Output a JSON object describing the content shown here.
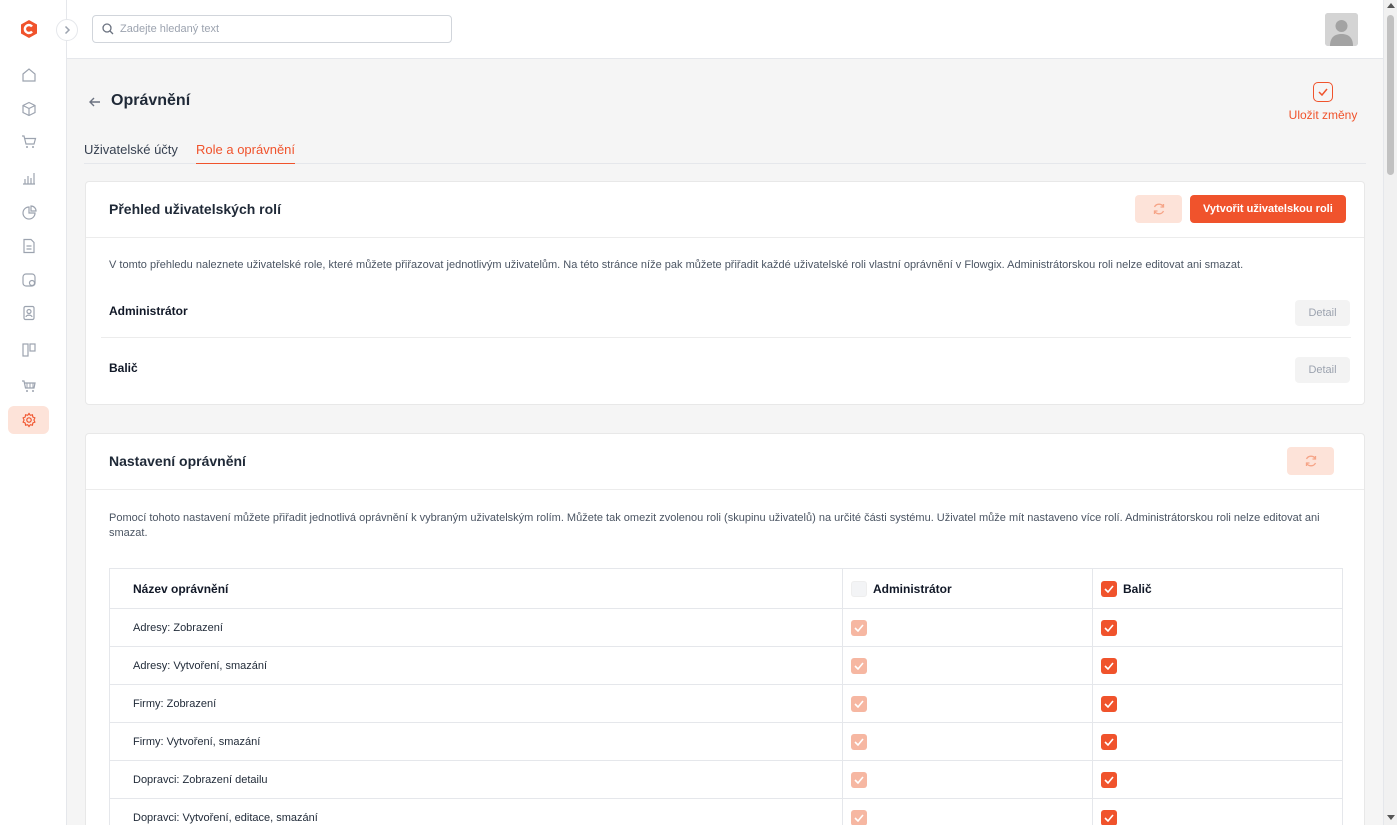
{
  "colors": {
    "accent": "#f0532c",
    "accent_soft": "#fde3d9"
  },
  "sidebar": {
    "items": [
      {
        "icon": "home-icon"
      },
      {
        "icon": "box-icon"
      },
      {
        "icon": "cart-icon"
      },
      {
        "icon": "chart-icon"
      },
      {
        "icon": "pie-chart-icon"
      },
      {
        "icon": "document-icon"
      },
      {
        "icon": "user-settings-icon"
      },
      {
        "icon": "contacts-icon"
      },
      {
        "icon": "kanban-icon"
      },
      {
        "icon": "shop-cart-icon"
      },
      {
        "icon": "gear-icon",
        "active": true
      }
    ]
  },
  "search": {
    "placeholder": "Zadejte hledaný text"
  },
  "page": {
    "title": "Oprávnění",
    "save_label": "Uložit změny",
    "tabs": [
      {
        "label": "Uživatelské účty"
      },
      {
        "label": "Role a oprávnění",
        "active": true
      }
    ]
  },
  "roles_card": {
    "title": "Přehled uživatelských rolí",
    "create_label": "Vytvořit uživatelskou roli",
    "description": "V tomto přehledu naleznete uživatelské role, které můžete přiřazovat jednotlivým uživatelům. Na této stránce níže pak můžete přiřadit každé uživatelské roli vlastní oprávnění v Flowgix. Administrátorskou roli nelze editovat ani smazat.",
    "roles": [
      {
        "name": "Administrátor",
        "detail_label": "Detail"
      },
      {
        "name": "Balič",
        "detail_label": "Detail"
      }
    ]
  },
  "permissions_card": {
    "title": "Nastavení oprávnění",
    "description": "Pomocí tohoto nastavení můžete přiřadit jednotlivá oprávnění k vybraným uživatelským rolím. Můžete tak omezit zvolenou roli (skupinu uživatelů) na určité části systému. Uživatel může mít nastaveno více rolí. Administrátorskou roli nelze editovat ani smazat.",
    "table": {
      "col_name": "Název oprávnění",
      "col_admin": "Administrátor",
      "col_balic": "Balič",
      "rows": [
        {
          "name": "Adresy: Zobrazení",
          "admin": true,
          "balic": true
        },
        {
          "name": "Adresy: Vytvoření, smazání",
          "admin": true,
          "balic": true
        },
        {
          "name": "Firmy: Zobrazení",
          "admin": true,
          "balic": true
        },
        {
          "name": "Firmy: Vytvoření, smazání",
          "admin": true,
          "balic": true
        },
        {
          "name": "Dopravci: Zobrazení detailu",
          "admin": true,
          "balic": true
        },
        {
          "name": "Dopravci: Vytvoření, editace, smazání",
          "admin": true,
          "balic": true
        }
      ]
    }
  }
}
